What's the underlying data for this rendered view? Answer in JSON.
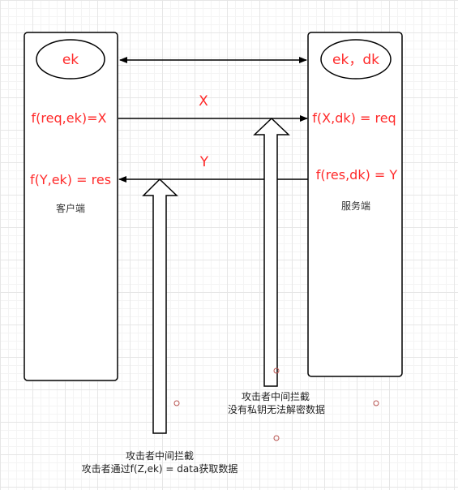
{
  "client": {
    "key_label": "ek",
    "encrypt_formula": "f(req,ek)=X",
    "decrypt_formula": "f(Y,ek) = res",
    "name": "客户端"
  },
  "server": {
    "key_label": "ek，dk",
    "decrypt_formula": "f(X,dk) = req",
    "encrypt_formula": "f(res,dk) = Y",
    "name": "服务端"
  },
  "messages": {
    "request": "X",
    "response": "Y"
  },
  "attackers": {
    "left": {
      "line1": "攻击者中间拦截",
      "line2": "攻击者通过f(Z,ek) = data获取数据"
    },
    "right": {
      "line1": "攻击者中间拦截",
      "line2": "没有私钥无法解密数据"
    }
  },
  "colors": {
    "label_red": "#ff2a2a",
    "stroke": "#000000",
    "text": "#333333",
    "marker": "#b85450"
  }
}
